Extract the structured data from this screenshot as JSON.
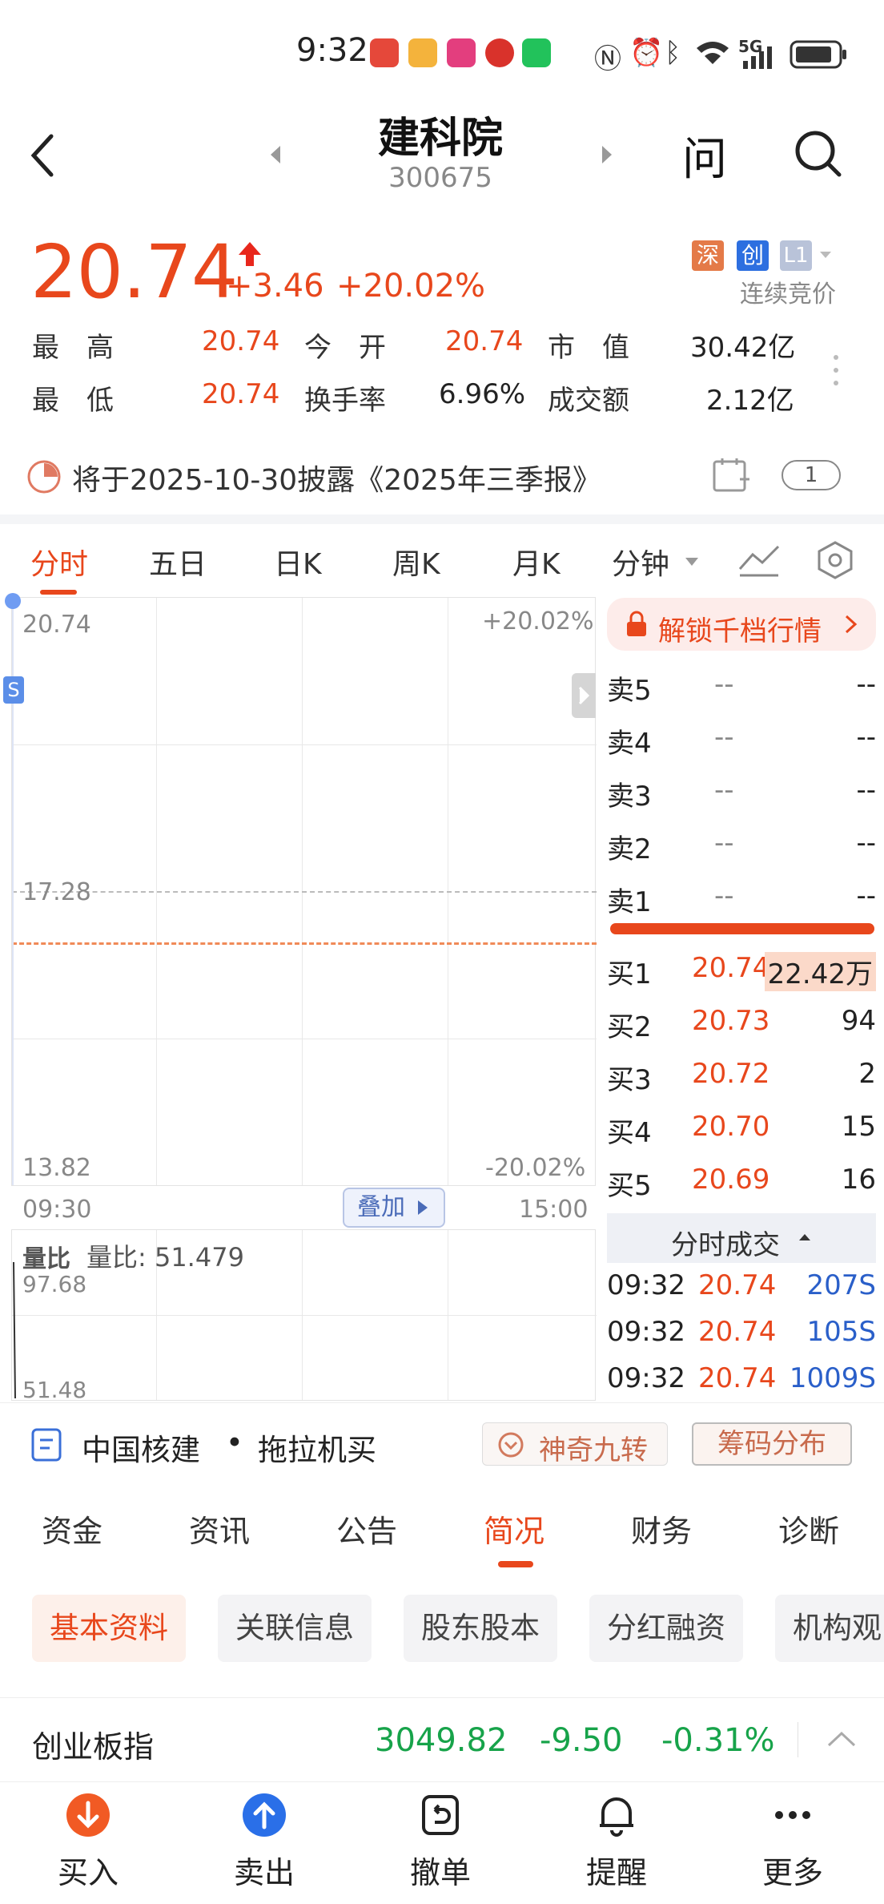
{
  "status_bar": {
    "time": "9:32",
    "network": "5G"
  },
  "header": {
    "title": "建科院",
    "code": "300675",
    "ask_label": "问"
  },
  "quote": {
    "price": "20.74",
    "change": "+3.46",
    "change_pct": "+20.02%",
    "badges": [
      "深",
      "创",
      "L1"
    ],
    "auction_label": "连续竞价",
    "stats": [
      {
        "label": "最　高",
        "value": "20.74"
      },
      {
        "label": "今　开",
        "value": "20.74"
      },
      {
        "label": "市　值",
        "value": "30.42亿"
      },
      {
        "label": "最　低",
        "value": "20.74"
      },
      {
        "label": "换手率",
        "value": "6.96%"
      },
      {
        "label": "成交额",
        "value": "2.12亿"
      }
    ]
  },
  "notice": {
    "text": "将于2025-10-30披露《2025年三季报》",
    "count": "1"
  },
  "chart_tabs": [
    "分时",
    "五日",
    "日K",
    "周K",
    "月K",
    "分钟"
  ],
  "chart": {
    "price_top": "20.74",
    "price_mid": "17.28",
    "price_bottom": "13.82",
    "pct_top": "+20.02%",
    "pct_bottom": "-20.02%",
    "time_start": "09:30",
    "time_end": "15:00",
    "overlay_label": "叠加",
    "s_marker": "S",
    "volume_ratio_label": "量比",
    "volume_ratio_text": "量比:  51.479",
    "vr_top": "97.68",
    "vr_bottom": "51.48"
  },
  "order_book": {
    "unlock_label": "解锁千档行情",
    "asks": [
      {
        "label": "卖5",
        "price": "--",
        "vol": "--"
      },
      {
        "label": "卖4",
        "price": "--",
        "vol": "--"
      },
      {
        "label": "卖3",
        "price": "--",
        "vol": "--"
      },
      {
        "label": "卖2",
        "price": "--",
        "vol": "--"
      },
      {
        "label": "卖1",
        "price": "--",
        "vol": "--"
      }
    ],
    "bids": [
      {
        "label": "买1",
        "price": "20.74",
        "vol": "22.42万"
      },
      {
        "label": "买2",
        "price": "20.73",
        "vol": "94"
      },
      {
        "label": "买3",
        "price": "20.72",
        "vol": "2"
      },
      {
        "label": "买4",
        "price": "20.70",
        "vol": "15"
      },
      {
        "label": "买5",
        "price": "20.69",
        "vol": "16"
      }
    ],
    "trades_title": "分时成交",
    "trades": [
      {
        "time": "09:32",
        "price": "20.74",
        "vol": "207S"
      },
      {
        "time": "09:32",
        "price": "20.74",
        "vol": "105S"
      },
      {
        "time": "09:32",
        "price": "20.74",
        "vol": "1009S"
      }
    ]
  },
  "concept_bar": {
    "tag1": "中国核建",
    "dot": "•",
    "tag2": "拖拉机买",
    "btn1": "神奇九转",
    "btn2": "筹码分布"
  },
  "section_tabs": [
    "资金",
    "资讯",
    "公告",
    "简况",
    "财务",
    "诊断"
  ],
  "sub_tabs": [
    "基本资料",
    "关联信息",
    "股东股本",
    "分红融资",
    "机构观"
  ],
  "index_bar": {
    "name": "创业板指",
    "value": "3049.82",
    "change": "-9.50",
    "change_pct": "-0.31%"
  },
  "bottom_nav": [
    {
      "label": "买入",
      "icon": "buy-icon"
    },
    {
      "label": "卖出",
      "icon": "sell-icon"
    },
    {
      "label": "撤单",
      "icon": "cancel-order-icon"
    },
    {
      "label": "提醒",
      "icon": "bell-icon"
    },
    {
      "label": "更多",
      "icon": "more-icon"
    }
  ],
  "colors": {
    "up": "#e8471c",
    "down": "#17a34a",
    "accent": "#e8471c"
  }
}
